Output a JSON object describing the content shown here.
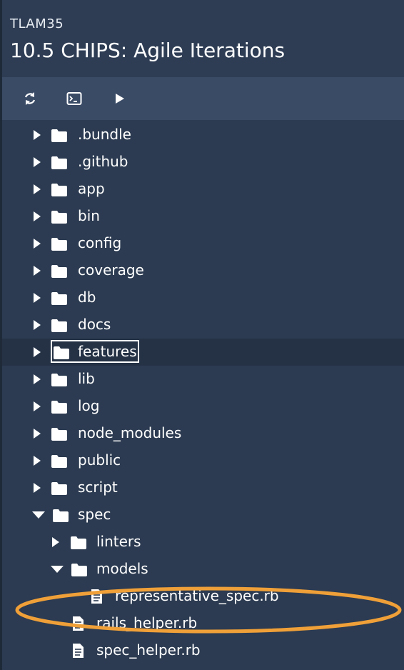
{
  "header": {
    "course_code": "TLAM35",
    "title": "10.5 CHIPS: Agile Iterations"
  },
  "toolbar": {
    "buttons": [
      {
        "icon": "refresh-icon"
      },
      {
        "icon": "terminal-icon"
      },
      {
        "icon": "play-icon"
      }
    ]
  },
  "tree": {
    "items": [
      {
        "label": ".bundle",
        "type": "folder",
        "expanded": false
      },
      {
        "label": ".github",
        "type": "folder",
        "expanded": false
      },
      {
        "label": "app",
        "type": "folder",
        "expanded": false
      },
      {
        "label": "bin",
        "type": "folder",
        "expanded": false
      },
      {
        "label": "config",
        "type": "folder",
        "expanded": false
      },
      {
        "label": "coverage",
        "type": "folder",
        "expanded": false
      },
      {
        "label": "db",
        "type": "folder",
        "expanded": false
      },
      {
        "label": "docs",
        "type": "folder",
        "expanded": false
      },
      {
        "label": "features",
        "type": "folder",
        "expanded": false,
        "selected": true
      },
      {
        "label": "lib",
        "type": "folder",
        "expanded": false
      },
      {
        "label": "log",
        "type": "folder",
        "expanded": false
      },
      {
        "label": "node_modules",
        "type": "folder",
        "expanded": false
      },
      {
        "label": "public",
        "type": "folder",
        "expanded": false
      },
      {
        "label": "script",
        "type": "folder",
        "expanded": false
      },
      {
        "label": "spec",
        "type": "folder",
        "expanded": true
      },
      {
        "label": "linters",
        "type": "folder",
        "expanded": false
      },
      {
        "label": "models",
        "type": "folder",
        "expanded": true
      },
      {
        "label": "representative_spec.rb",
        "type": "file",
        "highlighted": true
      },
      {
        "label": "rails_helper.rb",
        "type": "file"
      },
      {
        "label": "spec_helper.rb",
        "type": "file"
      }
    ]
  },
  "colors": {
    "background": "#2c3b51",
    "toolbar": "#3a4b66",
    "selected_row": "#253246",
    "highlight_annotation": "#f0a038"
  }
}
